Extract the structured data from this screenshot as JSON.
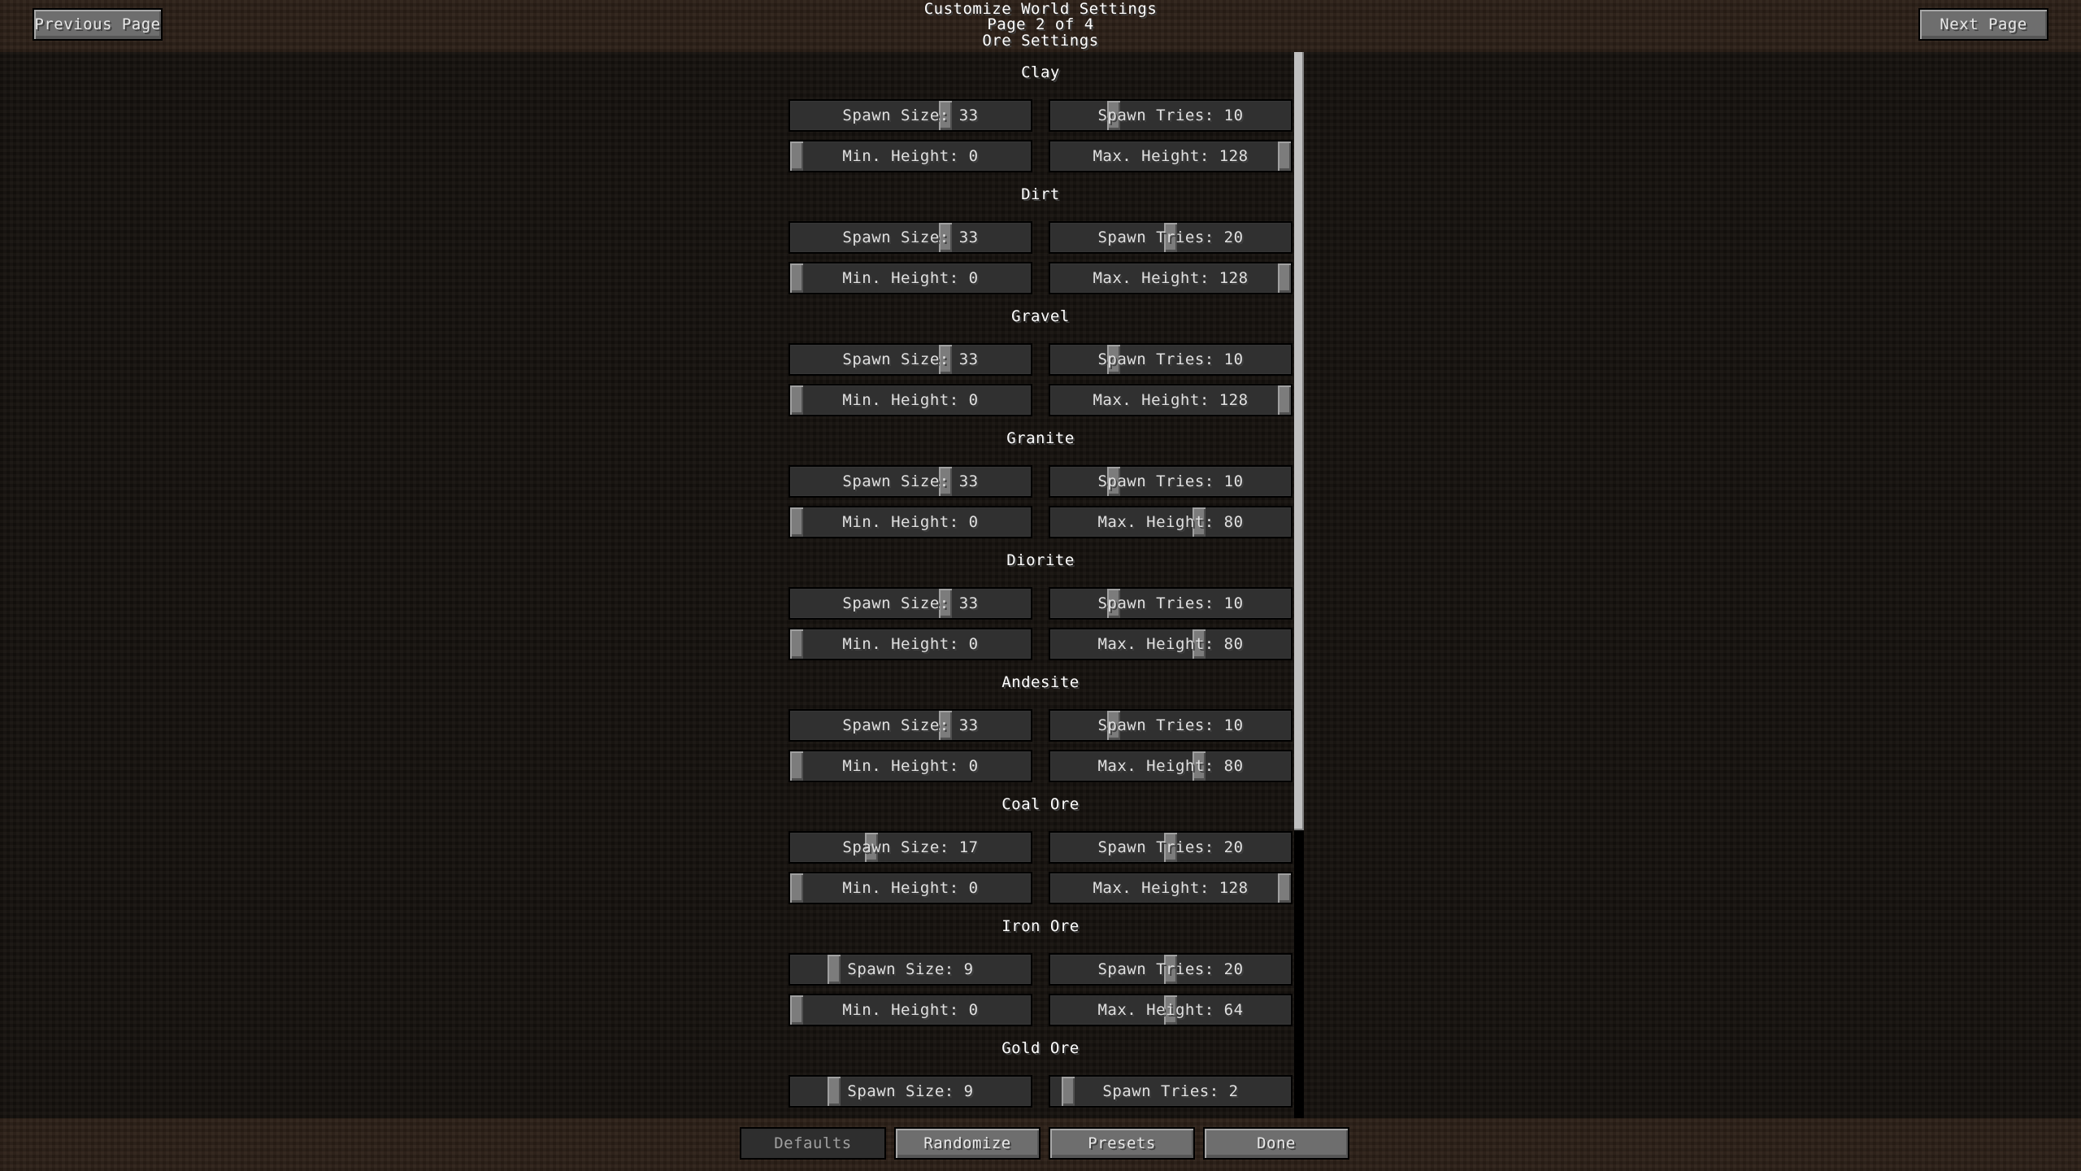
{
  "header": {
    "title": "Customize World Settings",
    "page_indicator": "Page 2 of 4",
    "page_name": "Ore Settings",
    "previous_label": "Previous Page",
    "next_label": "Next Page"
  },
  "sections": [
    {
      "name": "Clay",
      "sliders": [
        {
          "label": "Spawn Size: 33",
          "value": 33,
          "fraction": 0.653
        },
        {
          "label": "Spawn Tries: 10",
          "value": 10,
          "fraction": 0.25
        },
        {
          "label": "Min. Height: 0",
          "value": 0,
          "fraction": 0.0
        },
        {
          "label": "Max. Height: 128",
          "value": 128,
          "fraction": 1.0
        }
      ]
    },
    {
      "name": "Dirt",
      "sliders": [
        {
          "label": "Spawn Size: 33",
          "value": 33,
          "fraction": 0.653
        },
        {
          "label": "Spawn Tries: 20",
          "value": 20,
          "fraction": 0.5
        },
        {
          "label": "Min. Height: 0",
          "value": 0,
          "fraction": 0.0
        },
        {
          "label": "Max. Height: 128",
          "value": 128,
          "fraction": 1.0
        }
      ]
    },
    {
      "name": "Gravel",
      "sliders": [
        {
          "label": "Spawn Size: 33",
          "value": 33,
          "fraction": 0.653
        },
        {
          "label": "Spawn Tries: 10",
          "value": 10,
          "fraction": 0.25
        },
        {
          "label": "Min. Height: 0",
          "value": 0,
          "fraction": 0.0
        },
        {
          "label": "Max. Height: 128",
          "value": 128,
          "fraction": 1.0
        }
      ]
    },
    {
      "name": "Granite",
      "sliders": [
        {
          "label": "Spawn Size: 33",
          "value": 33,
          "fraction": 0.653
        },
        {
          "label": "Spawn Tries: 10",
          "value": 10,
          "fraction": 0.25
        },
        {
          "label": "Min. Height: 0",
          "value": 0,
          "fraction": 0.0
        },
        {
          "label": "Max. Height: 80",
          "value": 80,
          "fraction": 0.625
        }
      ]
    },
    {
      "name": "Diorite",
      "sliders": [
        {
          "label": "Spawn Size: 33",
          "value": 33,
          "fraction": 0.653
        },
        {
          "label": "Spawn Tries: 10",
          "value": 10,
          "fraction": 0.25
        },
        {
          "label": "Min. Height: 0",
          "value": 0,
          "fraction": 0.0
        },
        {
          "label": "Max. Height: 80",
          "value": 80,
          "fraction": 0.625
        }
      ]
    },
    {
      "name": "Andesite",
      "sliders": [
        {
          "label": "Spawn Size: 33",
          "value": 33,
          "fraction": 0.653
        },
        {
          "label": "Spawn Tries: 10",
          "value": 10,
          "fraction": 0.25
        },
        {
          "label": "Min. Height: 0",
          "value": 0,
          "fraction": 0.0
        },
        {
          "label": "Max. Height: 80",
          "value": 80,
          "fraction": 0.625
        }
      ]
    },
    {
      "name": "Coal Ore",
      "sliders": [
        {
          "label": "Spawn Size: 17",
          "value": 17,
          "fraction": 0.327
        },
        {
          "label": "Spawn Tries: 20",
          "value": 20,
          "fraction": 0.5
        },
        {
          "label": "Min. Height: 0",
          "value": 0,
          "fraction": 0.0
        },
        {
          "label": "Max. Height: 128",
          "value": 128,
          "fraction": 1.0
        }
      ]
    },
    {
      "name": "Iron Ore",
      "sliders": [
        {
          "label": "Spawn Size: 9",
          "value": 9,
          "fraction": 0.163
        },
        {
          "label": "Spawn Tries: 20",
          "value": 20,
          "fraction": 0.5
        },
        {
          "label": "Min. Height: 0",
          "value": 0,
          "fraction": 0.0
        },
        {
          "label": "Max. Height: 64",
          "value": 64,
          "fraction": 0.5
        }
      ]
    },
    {
      "name": "Gold Ore",
      "sliders": [
        {
          "label": "Spawn Size: 9",
          "value": 9,
          "fraction": 0.163
        },
        {
          "label": "Spawn Tries: 2",
          "value": 2,
          "fraction": 0.05
        }
      ]
    }
  ],
  "scrollbar": {
    "position": 0.0,
    "visible_fraction": 0.73
  },
  "footer": {
    "defaults_label": "Defaults",
    "defaults_enabled": false,
    "randomize_label": "Randomize",
    "presets_label": "Presets",
    "done_label": "Done"
  }
}
